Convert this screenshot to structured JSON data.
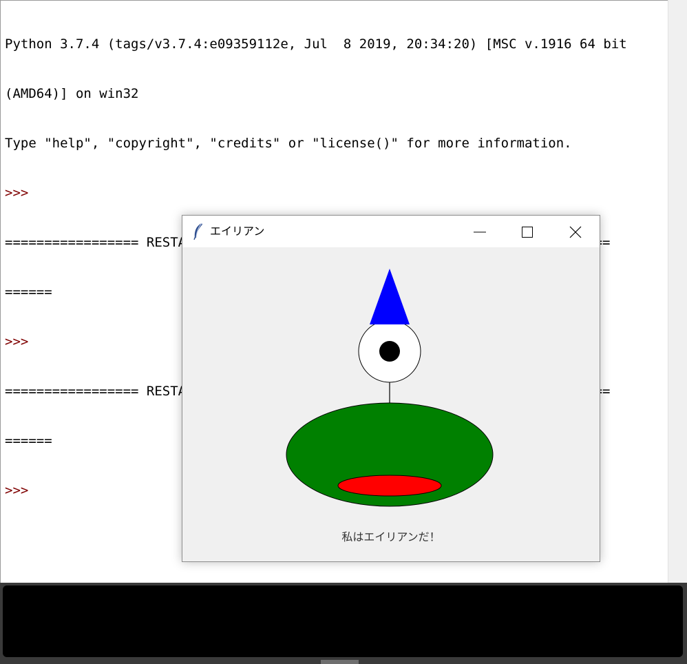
{
  "shell": {
    "lines": [
      "Python 3.7.4 (tags/v3.7.4:e09359112e, Jul  8 2019, 20:34:20) [MSC v.1916 64 bit",
      "(AMD64)] on win32",
      "Type \"help\", \"copyright\", \"credits\" or \"license()\" for more information.",
      ">>>",
      "================= RESTART: C:\\dissy1q84\\Python\\エイリアンをかこう.py ===========",
      "======",
      ">>>",
      "================= RESTART: C:\\dissy1q84\\Python\\エイリアンをかこう.py ===========",
      "======",
      ">>>"
    ]
  },
  "tk_window": {
    "title": "エイリアン",
    "icon": "feather-icon",
    "buttons": [
      "minimize-icon",
      "maximize-icon",
      "close-icon"
    ],
    "message": "私はエイリアンだ！"
  },
  "alien": {
    "body_color": "#008000",
    "mouth_color": "#ff0000",
    "eye_color": "#ffffff",
    "pupil_color": "#000000",
    "hat_color": "#0000ff"
  }
}
